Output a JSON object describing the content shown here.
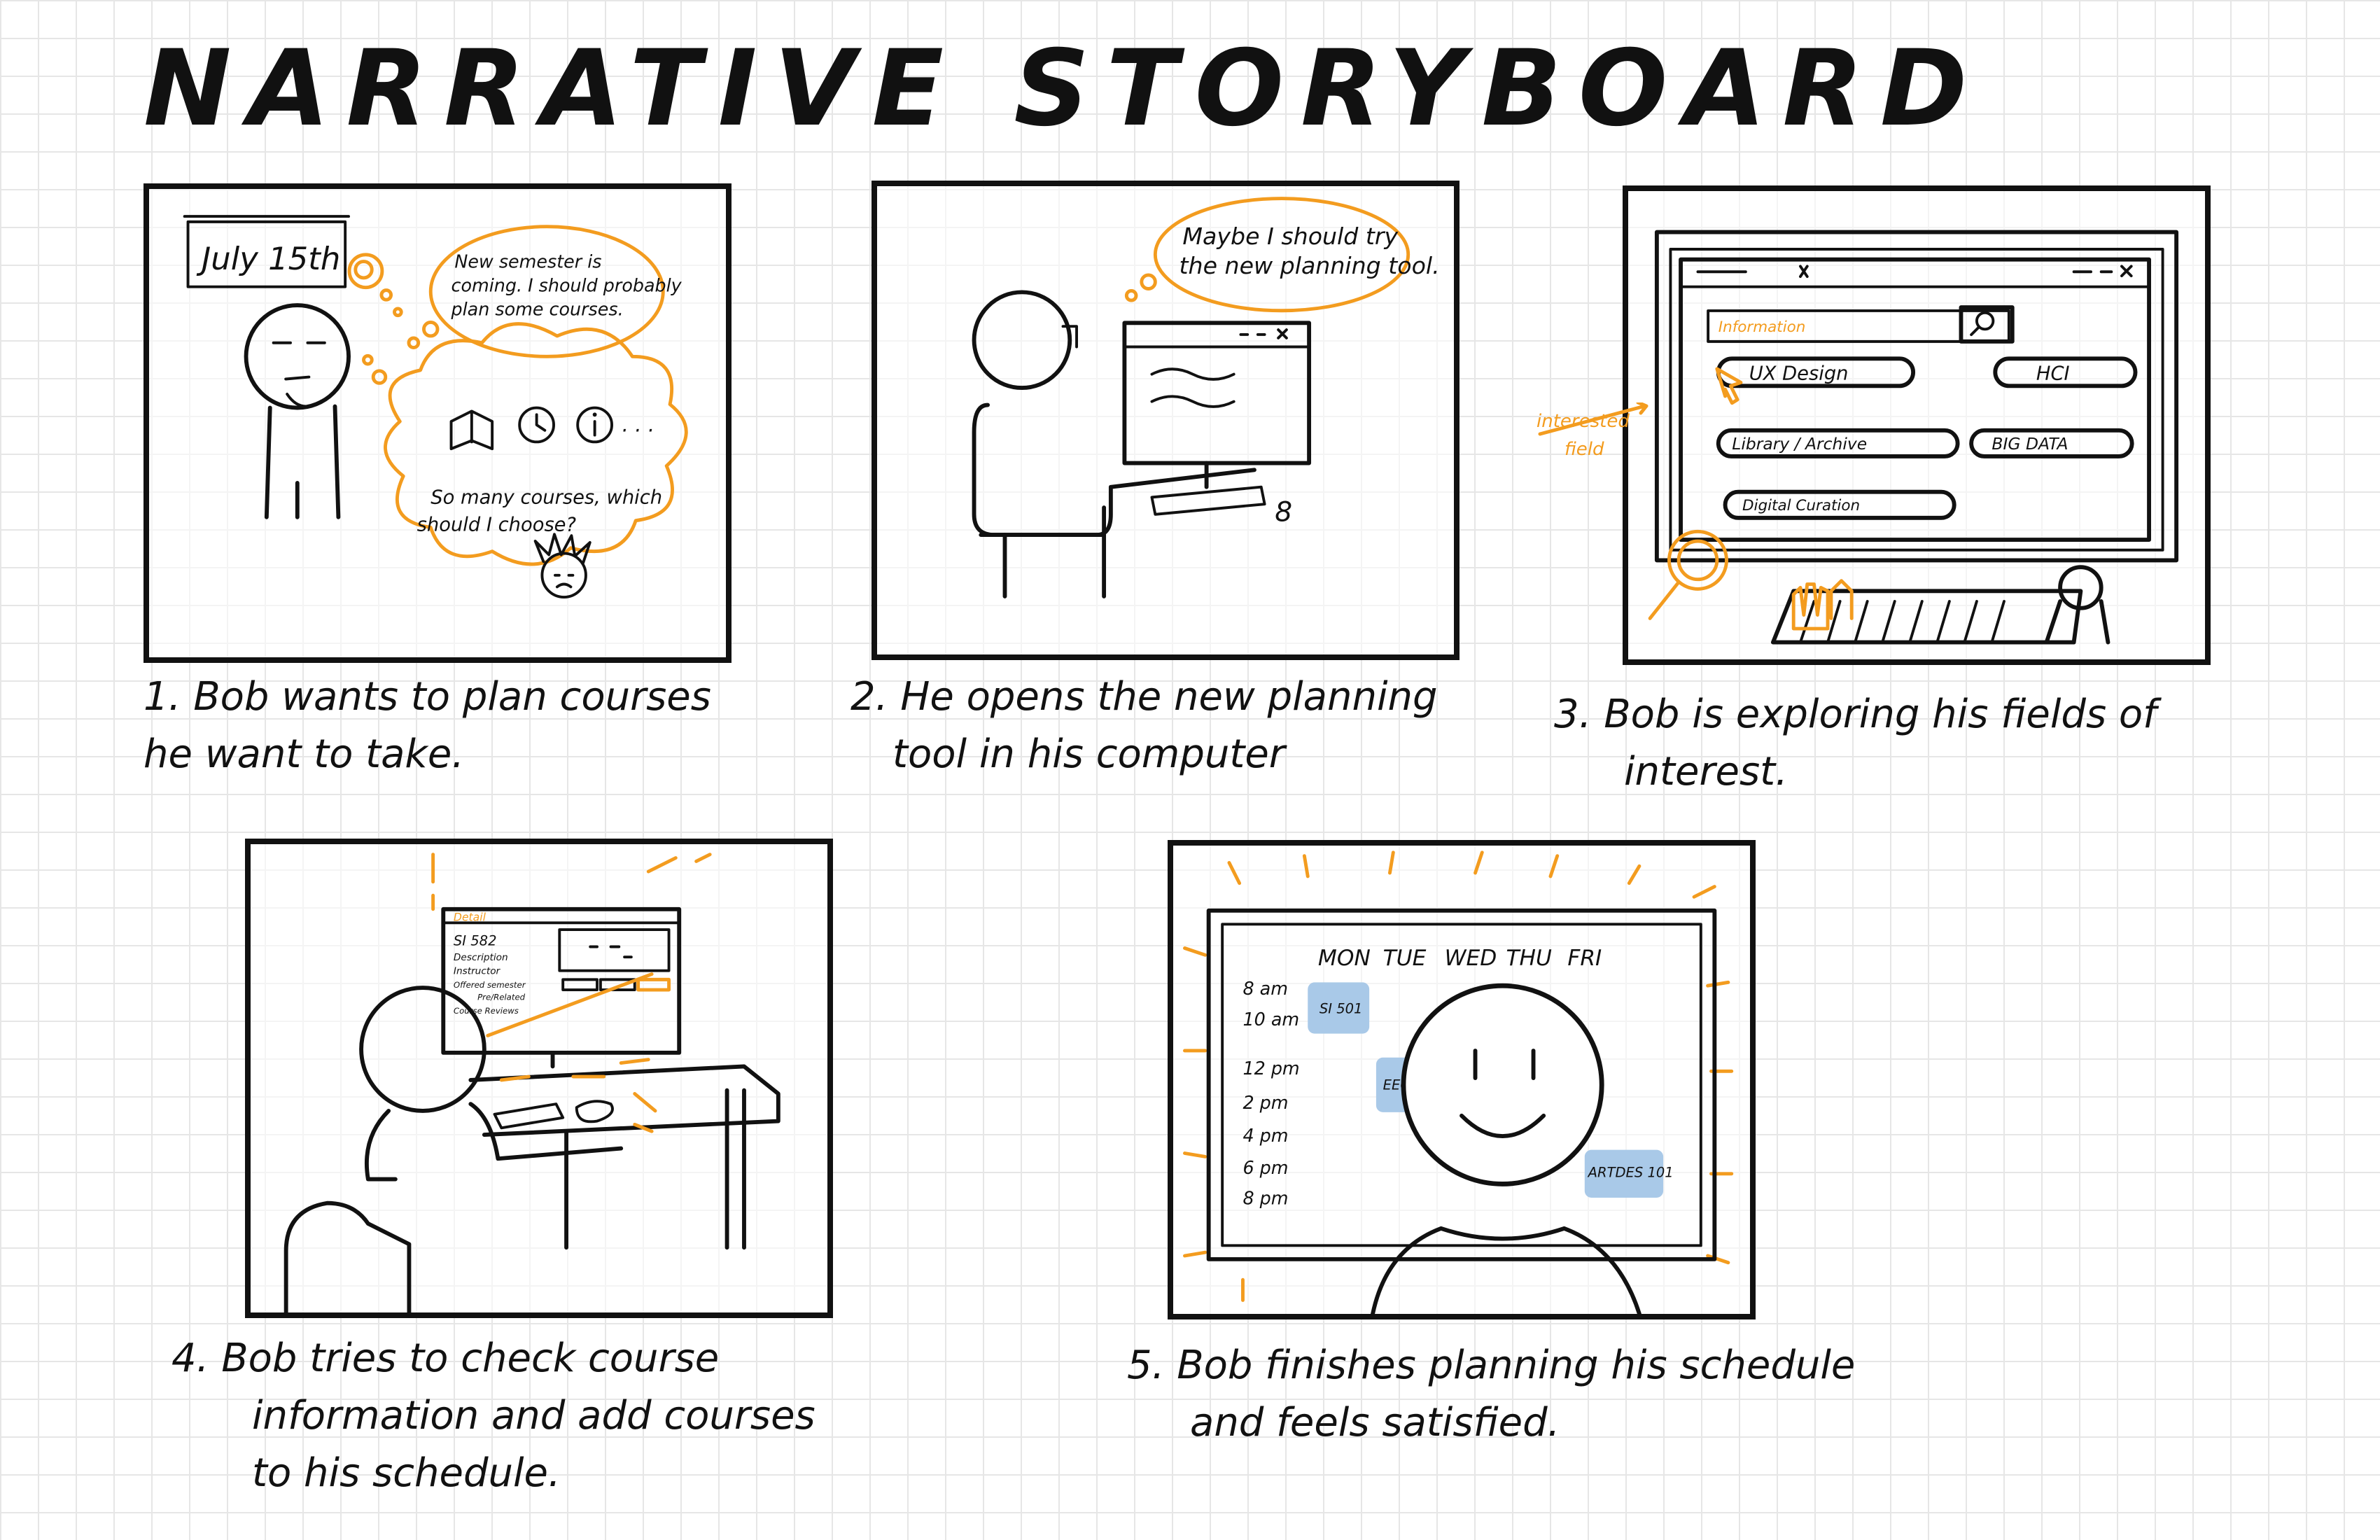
{
  "title": "NARRATIVE STORYBOARD",
  "colors": {
    "accent": "#f39c1f",
    "ink": "#111111",
    "highlight": "#a9c9e8",
    "grid": "#e6e6e6"
  },
  "panels": [
    {
      "caption": "1. Bob wants to plan courses he want to take.",
      "caption_lines": [
        "1. Bob wants to plan courses",
        "he want to take."
      ],
      "calendar": "July 15th",
      "thought_1": [
        "New semester is",
        "coming. I should probably",
        "plan some courses."
      ],
      "thought_2": [
        "So many courses, which",
        "should I choose?"
      ]
    },
    {
      "caption": "2. He opens the new planning tool in his computer",
      "caption_lines": [
        "2. He opens the new planning",
        "tool in his computer"
      ],
      "thought": [
        "Maybe I should try",
        "the new planning tool."
      ]
    },
    {
      "caption": "3. Bob is exploring his fields of interest.",
      "caption_lines": [
        "3. Bob is exploring his fields of",
        "interest."
      ],
      "search_placeholder": "Information",
      "fields": [
        "UX Design",
        "HCI",
        "Library / Archive",
        "BIG DATA",
        "Digital Curation"
      ],
      "annotation": [
        "interested",
        "field"
      ]
    },
    {
      "caption": "4. Bob tries to check course information and add courses to his schedule.",
      "caption_lines": [
        "4. Bob tries to check course",
        "information and add courses",
        "to his schedule."
      ],
      "screen_tab": "Detail",
      "screen_lines": [
        "SI 582",
        "Description",
        "Instructor",
        "Offered semester",
        "Pre/Related",
        "Course Reviews"
      ]
    },
    {
      "caption": "5. Bob finishes planning his schedule and feels satisfied.",
      "caption_lines": [
        "5. Bob finishes planning his schedule",
        "and feels satisfied."
      ],
      "days": [
        "MON",
        "TUE",
        "WED",
        "THU",
        "FRI"
      ],
      "times": [
        "8 am",
        "10 am",
        "12 pm",
        "2 pm",
        "4 pm",
        "6 pm",
        "8 pm"
      ],
      "courses": [
        "SI 501",
        "EECS 4",
        "ARTDES 101"
      ]
    }
  ]
}
